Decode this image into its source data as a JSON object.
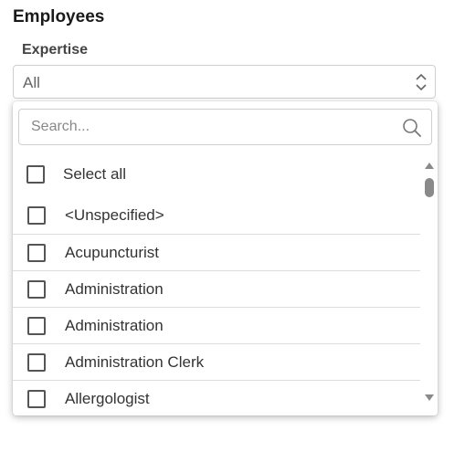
{
  "section": {
    "title": "Employees"
  },
  "field": {
    "label": "Expertise",
    "selected_value": "All"
  },
  "dropdown": {
    "search_placeholder": "Search...",
    "select_all_label": "Select all",
    "options": [
      {
        "label": "<Unspecified>",
        "checked": false
      },
      {
        "label": "Acupuncturist",
        "checked": false
      },
      {
        "label": "Administration",
        "checked": false
      },
      {
        "label": "Administration",
        "checked": false
      },
      {
        "label": "Administration Clerk",
        "checked": false
      },
      {
        "label": "Allergologist",
        "checked": false
      }
    ]
  },
  "colors": {
    "border": "#cfcfcf",
    "checkbox_border": "#555555",
    "scroll_thumb": "#8a8a8a"
  }
}
